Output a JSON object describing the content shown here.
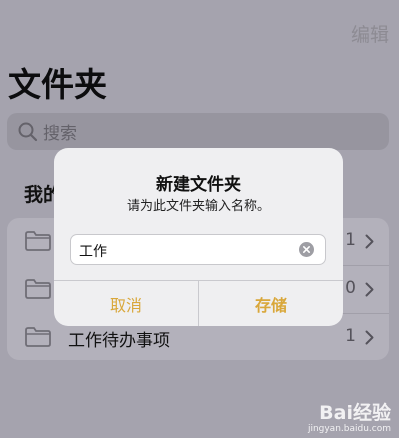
{
  "header": {
    "edit_label": "编辑",
    "title": "文件夹"
  },
  "search": {
    "placeholder": "搜索"
  },
  "section": {
    "title": "我的"
  },
  "folders": [
    {
      "name": "",
      "count": "1"
    },
    {
      "name": "",
      "count": "0"
    },
    {
      "name": "工作待办事项",
      "count": "1"
    }
  ],
  "dialog": {
    "title": "新建文件夹",
    "message": "请为此文件夹输入名称。",
    "input_value": "工作",
    "cancel_label": "取消",
    "save_label": "存储"
  },
  "watermark": {
    "logo": "Bai经验",
    "url": "jingyan.baidu.com"
  },
  "colors": {
    "accent": "#d9a73a",
    "dim_background": "#a5a3ae",
    "dialog_bg": "#efeff1"
  }
}
